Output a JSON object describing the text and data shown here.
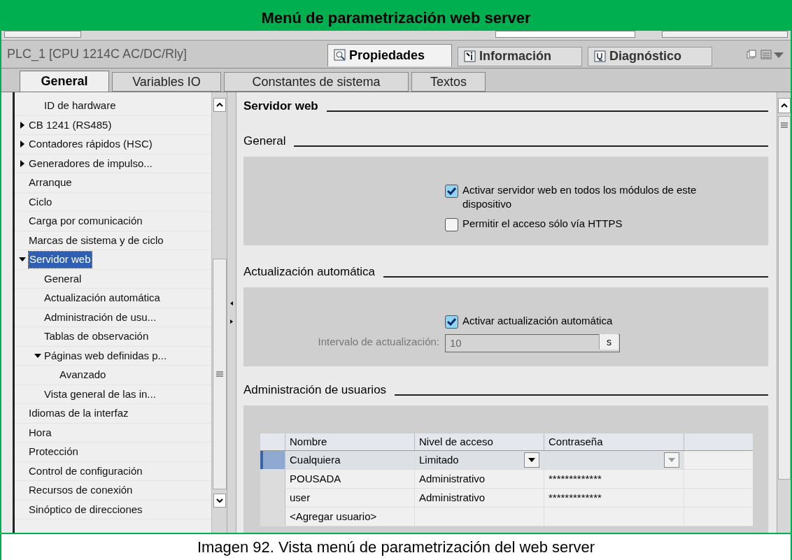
{
  "header": {
    "title": "Menú de parametrización web server"
  },
  "inspector": {
    "title": "PLC_1 [CPU 1214C AC/DC/Rly]",
    "view_tabs": [
      {
        "label": "Propiedades",
        "selected": true
      },
      {
        "label": "Información",
        "selected": false
      },
      {
        "label": "Diagnóstico",
        "selected": false
      }
    ],
    "tabs": [
      {
        "label": "General",
        "selected": true
      },
      {
        "label": "Variables IO",
        "selected": false
      },
      {
        "label": "Constantes de sistema",
        "selected": false
      },
      {
        "label": "Textos",
        "selected": false
      }
    ]
  },
  "tree": [
    {
      "children": [
        {
          "label": "ID de hardware",
          "selected": false
        }
      ]
    },
    {
      "label": "CB 1241 (RS485)",
      "expanded": false,
      "selected": false
    },
    {
      "label": "Contadores rápidos (HSC)",
      "expanded": false,
      "selected": false
    },
    {
      "label": "Generadores de impulso...",
      "expanded": false,
      "selected": false
    },
    {
      "label": "Arranque",
      "selected": false
    },
    {
      "label": "Ciclo",
      "selected": false
    },
    {
      "label": "Carga por comunicación",
      "selected": false
    },
    {
      "label": "Marcas de sistema y de ciclo",
      "selected": false
    },
    {
      "label": "Servidor web",
      "expanded": true,
      "selected": true,
      "children": [
        {
          "label": "General",
          "selected": false
        },
        {
          "label": "Actualización automática",
          "selected": false
        },
        {
          "label": "Administración de usu...",
          "selected": false
        },
        {
          "label": "Tablas de observación",
          "selected": false
        },
        {
          "label": "Páginas web definidas p...",
          "expanded": true,
          "selected": false,
          "children": [
            {
              "label": "Avanzado",
              "selected": false
            }
          ]
        },
        {
          "label": "Vista general de las in...",
          "selected": false
        }
      ]
    },
    {
      "label": "Idiomas de la interfaz",
      "selected": false
    },
    {
      "label": "Hora",
      "selected": false
    },
    {
      "label": "Protección",
      "selected": false
    },
    {
      "label": "Control de configuración",
      "selected": false
    },
    {
      "label": "Recursos de conexión",
      "selected": false
    },
    {
      "label": "Sinóptico de direcciones",
      "selected": false
    }
  ],
  "content": {
    "heading": "Servidor web",
    "sections": [
      {
        "title": "General",
        "options": [
          {
            "kind": "checkbox",
            "label": "Activar servidor web en todos los módulos de este dispositivo",
            "checked": true
          },
          {
            "kind": "checkbox",
            "label": "Permitir el acceso sólo vía HTTPS",
            "checked": false
          }
        ]
      },
      {
        "title": "Actualización automática",
        "options": [
          {
            "kind": "checkbox",
            "label": "Activar actualización automática",
            "checked": true
          },
          {
            "kind": "field",
            "label": "Intervalo de actualización:",
            "value": "10",
            "unit": "s",
            "disabled": true
          }
        ]
      },
      {
        "title": "Administración de usuarios",
        "table": {
          "columns": [
            "Nombre",
            "Nivel de acceso",
            "Contraseña"
          ],
          "rows": [
            {
              "cells": [
                "Cualquiera",
                "Limitado",
                ""
              ],
              "selected": true
            },
            {
              "cells": [
                "POUSADA",
                "Administrativo",
                "*************"
              ],
              "selected": false
            },
            {
              "cells": [
                "user",
                "Administrativo",
                "*************"
              ],
              "selected": false
            },
            {
              "cells": [
                "<Agregar usuario>",
                "",
                ""
              ],
              "selected": false
            }
          ]
        }
      }
    ]
  },
  "caption": "Imagen 92. Vista menú de parametrización del web server"
}
